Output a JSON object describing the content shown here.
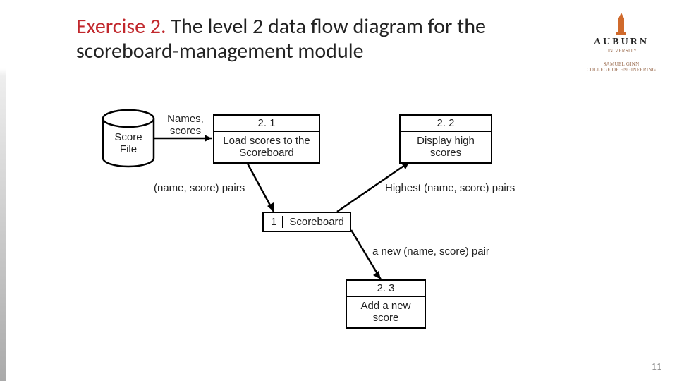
{
  "title": {
    "prefix": "Exercise 2.",
    "rest": " The level 2 data flow diagram for the scoreboard-management module"
  },
  "logo": {
    "name": "AUBURN",
    "sub1": "UNIVERSITY",
    "sub2": "SAMUEL GINN",
    "sub3": "COLLEGE OF ENGINEERING"
  },
  "datastore": {
    "label": "Score\nFile"
  },
  "flow_labels": {
    "names_scores": "Names,\nscores",
    "name_score_pairs": "(name, score) pairs",
    "highest_pairs": "Highest (name, score) pairs",
    "a_new_pair": "a new (name, score) pair"
  },
  "processes": {
    "p21": {
      "num": "2. 1",
      "text": "Load scores to the Scoreboard"
    },
    "p22": {
      "num": "2. 2",
      "text": "Display high scores"
    },
    "p1": {
      "num": "1",
      "text": "Scoreboard"
    },
    "p23": {
      "num": "2. 3",
      "text": "Add a new score"
    }
  },
  "page_number": "11"
}
